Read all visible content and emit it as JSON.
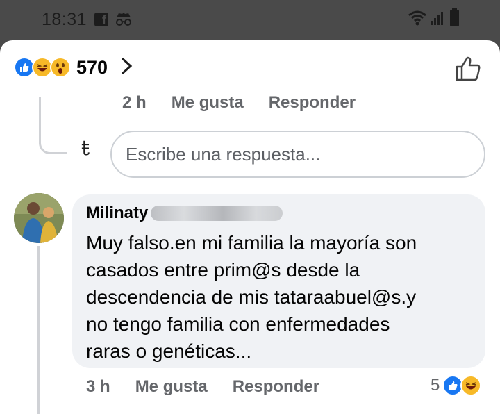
{
  "status_bar": {
    "time": "18:31",
    "icons": [
      "facebook-icon",
      "incognito-icon",
      "wifi-icon",
      "signal-icon",
      "battery-icon"
    ]
  },
  "reactions_header": {
    "icons": [
      "like-reaction-icon",
      "haha-reaction-icon",
      "wow-reaction-icon"
    ],
    "count": "570"
  },
  "previous_reply": {
    "time": "2 h",
    "like_label": "Me gusta",
    "reply_label": "Responder"
  },
  "reply_box": {
    "placeholder": "Escribe una respuesta..."
  },
  "comment": {
    "author": "Milinaty",
    "text": "Muy falso.en mi familia la mayoría son\ncasados entre prim@s desde la\ndescendencia de mis tataraabuel@s.y\nno tengo familia con enfermedades\nraras o genéticas...",
    "time": "3 h",
    "like_label": "Me gusta",
    "reply_label": "Responder",
    "reaction_count": "5",
    "reaction_icons": [
      "like-reaction-icon",
      "haha-reaction-icon"
    ]
  },
  "colors": {
    "facebook_blue": "#1877f2",
    "reaction_yellow": "#f7b928",
    "meta_gray": "#65676b",
    "bubble_bg": "#f0f2f5"
  }
}
